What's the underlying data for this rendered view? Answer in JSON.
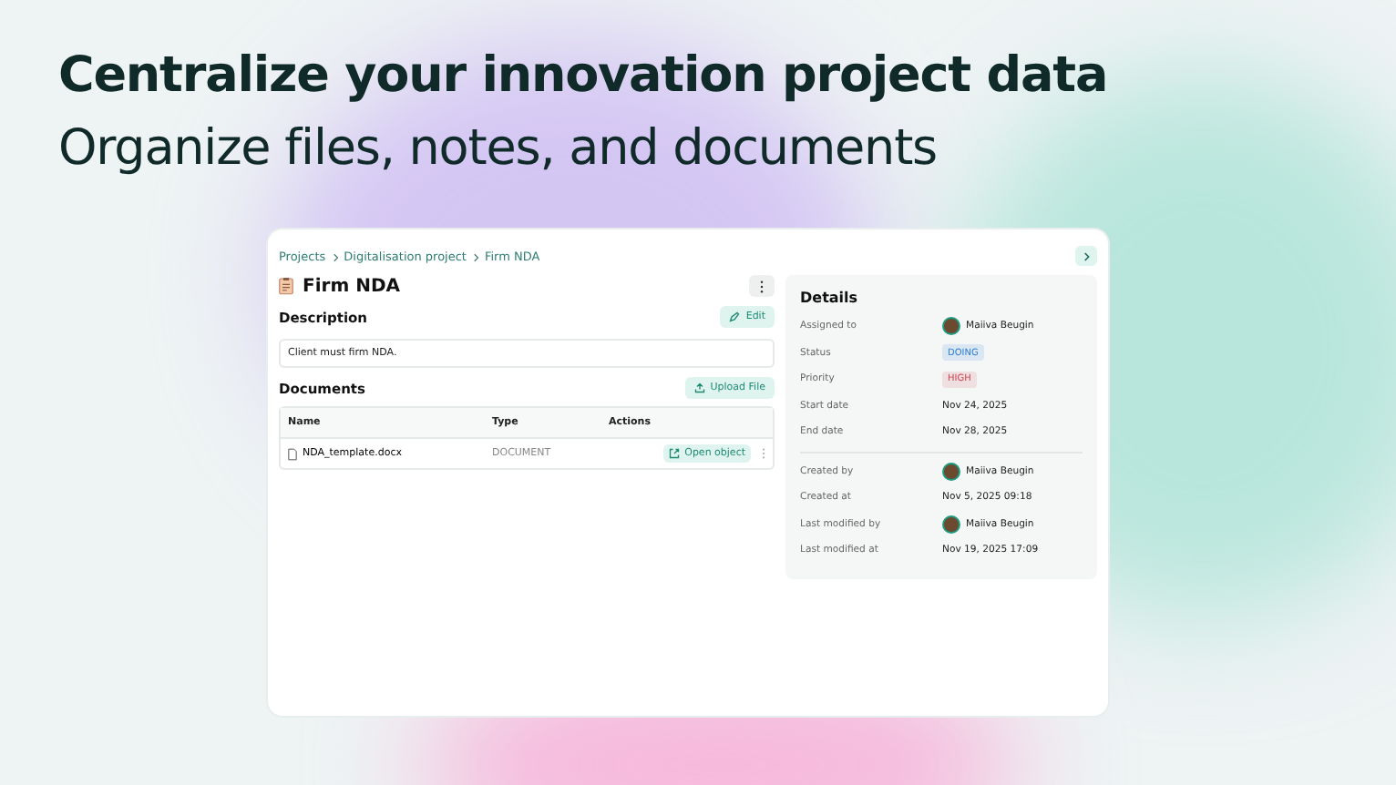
{
  "headline": [
    "Centralize your innovation project data",
    "Organize files, notes, and documents"
  ],
  "breadcrumbs": [
    "Projects",
    "Digitalisation project",
    "Firm NDA"
  ],
  "title": "Firm NDA",
  "description": {
    "heading": "Description",
    "edit_button": "Edit",
    "text": "Client must firm NDA."
  },
  "documents": {
    "heading": "Documents",
    "upload_button": "Upload File",
    "columns": [
      "Name",
      "Type",
      "Actions"
    ],
    "rows": [
      {
        "name": "NDA_template.docx",
        "type": "DOCUMENT",
        "action": "Open object"
      }
    ]
  },
  "details": {
    "title": "Details",
    "groups": [
      [
        {
          "label": "Assigned to",
          "kind": "person",
          "value": "Maiiva Beugin"
        },
        {
          "label": "Status",
          "kind": "badge",
          "value": "DOING",
          "color": "#2f7fd0"
        },
        {
          "label": "Priority",
          "kind": "badge",
          "value": "HIGH",
          "color": "#d0404f"
        },
        {
          "label": "Start date",
          "kind": "text",
          "value": "Nov 24, 2025"
        },
        {
          "label": "End date",
          "kind": "text",
          "value": "Nov 28, 2025"
        }
      ],
      [
        {
          "label": "Created by",
          "kind": "person",
          "value": "Maiiva Beugin"
        },
        {
          "label": "Created at",
          "kind": "text",
          "value": "Nov 5, 2025 09:18"
        },
        {
          "label": "Last modified by",
          "kind": "person",
          "value": "Maiiva Beugin"
        },
        {
          "label": "Last modified at",
          "kind": "text",
          "value": "Nov 19, 2025 17:09"
        }
      ]
    ]
  }
}
